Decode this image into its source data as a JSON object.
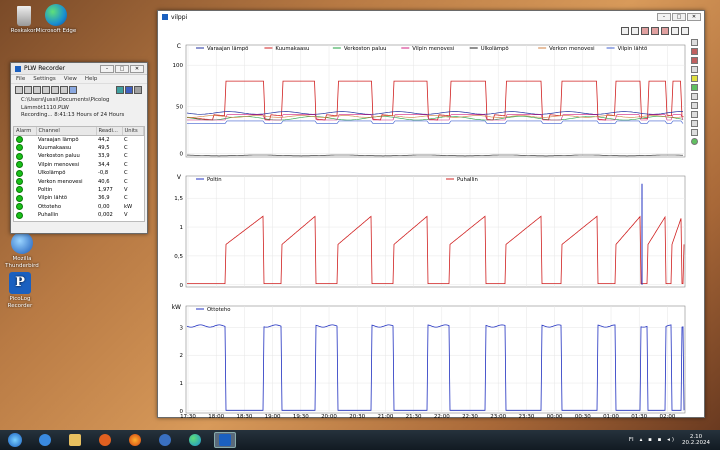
{
  "desktop": {
    "icons": [
      {
        "name": "Roskakori",
        "icon": "recycle-bin-icon"
      },
      {
        "name": "Microsoft Edge",
        "icon": "edge-icon"
      },
      {
        "name": "Mozilla Thunderbird",
        "icon": "thunderbird-icon"
      },
      {
        "name": "PicoLog Recorder",
        "icon": "picolog-icon"
      }
    ]
  },
  "recorder": {
    "title": "PLW Recorder",
    "menu": [
      "File",
      "Settings",
      "View",
      "Help"
    ],
    "path": "C:\\Users\\Jussi\\Documents\\Picolog",
    "file": "Lämmöt1110.PLW",
    "status": "Recording... 8:41:13 Hours of 24 Hours",
    "headers": [
      "Alarm",
      "Channel",
      "Readi...",
      "Units"
    ],
    "rows": [
      {
        "channel": "Varaajan lämpö",
        "value": "44,2",
        "unit": "C"
      },
      {
        "channel": "Kuumakaasu",
        "value": "49,5",
        "unit": "C"
      },
      {
        "channel": "Verkoston paluu",
        "value": "33,9",
        "unit": "C"
      },
      {
        "channel": "Vilpin menovesi",
        "value": "34,4",
        "unit": "C"
      },
      {
        "channel": "Ulkolämpö",
        "value": "-0,8",
        "unit": "C"
      },
      {
        "channel": "Verkon menovesi",
        "value": "40,6",
        "unit": "C"
      },
      {
        "channel": "Poltin",
        "value": "1,977",
        "unit": "V"
      },
      {
        "channel": "Vilpin lähtö",
        "value": "36,9",
        "unit": "C"
      },
      {
        "channel": "Ottoteho",
        "value": "0,00",
        "unit": "kW"
      },
      {
        "channel": "Puhallin",
        "value": "0,002",
        "unit": "V"
      }
    ]
  },
  "graph": {
    "title": "vilppi",
    "panel1": {
      "unit": "C",
      "ticks": [
        "100",
        "50",
        "0"
      ],
      "legend": [
        {
          "name": "Varaajan lämpö",
          "color": "#2030a0"
        },
        {
          "name": "Kuumakaasu",
          "color": "#d02020"
        },
        {
          "name": "Verkoston paluu",
          "color": "#20a040"
        },
        {
          "name": "Vilpin menovesi",
          "color": "#d02080"
        },
        {
          "name": "Ulkolämpö",
          "color": "#202020"
        },
        {
          "name": "Verkon menovesi",
          "color": "#d08040"
        },
        {
          "name": "Vilpin lähtö",
          "color": "#4060d0"
        }
      ]
    },
    "panel2": {
      "unit": "V",
      "ticks": [
        "1,5",
        "1",
        "0,5",
        "0"
      ],
      "legend": [
        {
          "name": "Poltin",
          "color": "#2030c0"
        },
        {
          "name": "Puhallin",
          "color": "#d02020"
        }
      ]
    },
    "panel3": {
      "unit": "kW",
      "ticks": [
        "3",
        "2",
        "1",
        "0"
      ],
      "legend": [
        {
          "name": "Ottoteho",
          "color": "#2030c0"
        }
      ]
    },
    "time_labels": [
      "17:30",
      "18:00",
      "18:30",
      "19:00",
      "19:30",
      "20:00",
      "20:30",
      "21:00",
      "21:30",
      "22:00",
      "22:30",
      "23:00",
      "23:30",
      "00:00",
      "00:30",
      "01:00",
      "01:30",
      "02:00"
    ]
  },
  "taskbar": {
    "apps": [
      "start-icon",
      "ie-icon",
      "explorer-icon",
      "media-player-icon",
      "firefox-icon",
      "thunderbird-icon",
      "edge-icon",
      "picolog-icon"
    ],
    "lang": "FI",
    "time": "2.10",
    "date": "20.2.2024"
  }
}
